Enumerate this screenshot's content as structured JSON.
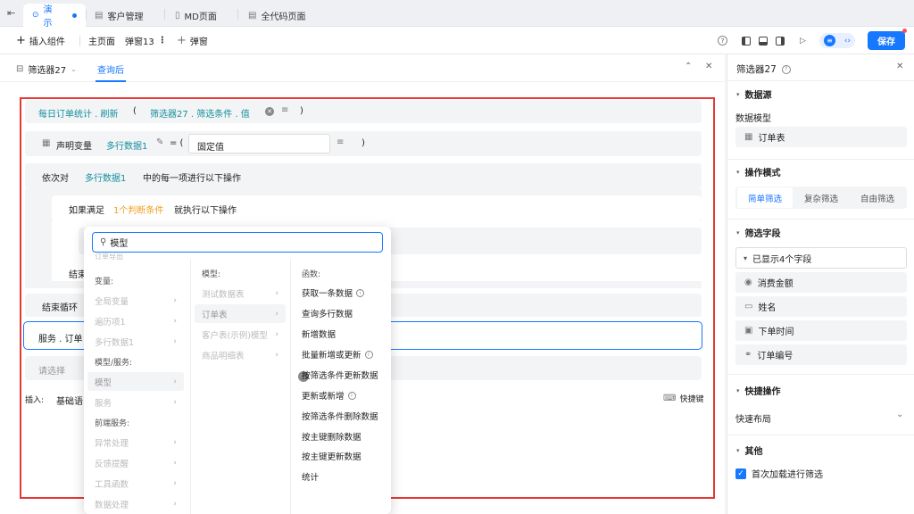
{
  "tabs": [
    {
      "label": "演示",
      "active": true
    },
    {
      "label": "客户管理",
      "active": false
    },
    {
      "label": "MD页面",
      "active": false
    },
    {
      "label": "全代码页面",
      "active": false
    }
  ],
  "toolbar": {
    "insert_component": "插入组件",
    "main_page": "主页面",
    "popup_current": "弹窗13",
    "add_popup": "弹窗",
    "save": "保存"
  },
  "subtabs": {
    "filter": "筛选器27",
    "after_query": "查询后"
  },
  "editor": {
    "line1": {
      "call": "每日订单统计 . 刷新",
      "open_paren": "(",
      "arg": "筛选器27 . 筛选条件 . 值",
      "close_paren": ")"
    },
    "line2": {
      "declare": "声明变量",
      "var": "多行数据1",
      "equals": "= (",
      "value": "固定值",
      "close_paren": ")"
    },
    "line3": {
      "prefix": "依次对",
      "var": "多行数据1",
      "suffix": "中的每一项进行以下操作"
    },
    "line4": {
      "prefix": "如果满足",
      "cond": "1个判断条件",
      "suffix": "就执行以下操作"
    },
    "line5": {
      "end": "结束"
    },
    "line6": {
      "end_loop": "结束循环"
    },
    "line7": {
      "service": "服务 . 订单"
    },
    "placeholder": "请选择",
    "insert_label": "插入:",
    "insert_basic": "基础语",
    "shortcut": "快捷键"
  },
  "dropdown": {
    "search_value": "模型",
    "col1_header_partial": "订单导出",
    "col1_vars_head": "变量:",
    "col1_vars": [
      "全局变量",
      "遍历项1",
      "多行数据1"
    ],
    "col1_models_head": "模型/服务:",
    "col1_models": [
      "模型",
      "服务"
    ],
    "col1_frontend_head": "前端服务:",
    "col1_frontend": [
      "异常处理",
      "反馈提醒",
      "工具函数",
      "数据处理"
    ],
    "col2_head": "模型:",
    "col2_items": [
      "测试数据表",
      "订单表",
      "客户表(示例)模型",
      "商品明细表"
    ],
    "col3_head": "函数:",
    "col3_items": [
      {
        "label": "获取一条数据",
        "info": true
      },
      {
        "label": "查询多行数据",
        "info": false
      },
      {
        "label": "新增数据",
        "info": false
      },
      {
        "label": "批量新增或更新",
        "info": true
      },
      {
        "label": "按筛选条件更新数据",
        "info": false
      },
      {
        "label": "更新或新增",
        "info": true
      },
      {
        "label": "按筛选条件删除数据",
        "info": false
      },
      {
        "label": "按主键删除数据",
        "info": false
      },
      {
        "label": "按主键更新数据",
        "info": false
      },
      {
        "label": "统计",
        "info": false
      }
    ]
  },
  "rightpanel": {
    "title": "筛选器27",
    "datasource_head": "数据源",
    "datamodel_label": "数据模型",
    "datamodel_value": "订单表",
    "mode_head": "操作模式",
    "modes": [
      "简单筛选",
      "复杂筛选",
      "自由筛选"
    ],
    "fields_head": "筛选字段",
    "fields_summary": "已显示4个字段",
    "fields": [
      "消费金额",
      "姓名",
      "下单时间",
      "订单编号"
    ],
    "quick_head": "快捷操作",
    "quick_layout": "快速布局",
    "other_head": "其他",
    "first_load": "首次加载进行筛选"
  },
  "colors": {
    "accent": "#1677ff",
    "highlight_border": "#e53935",
    "teal": "#15909c",
    "orange": "#f0a020"
  }
}
